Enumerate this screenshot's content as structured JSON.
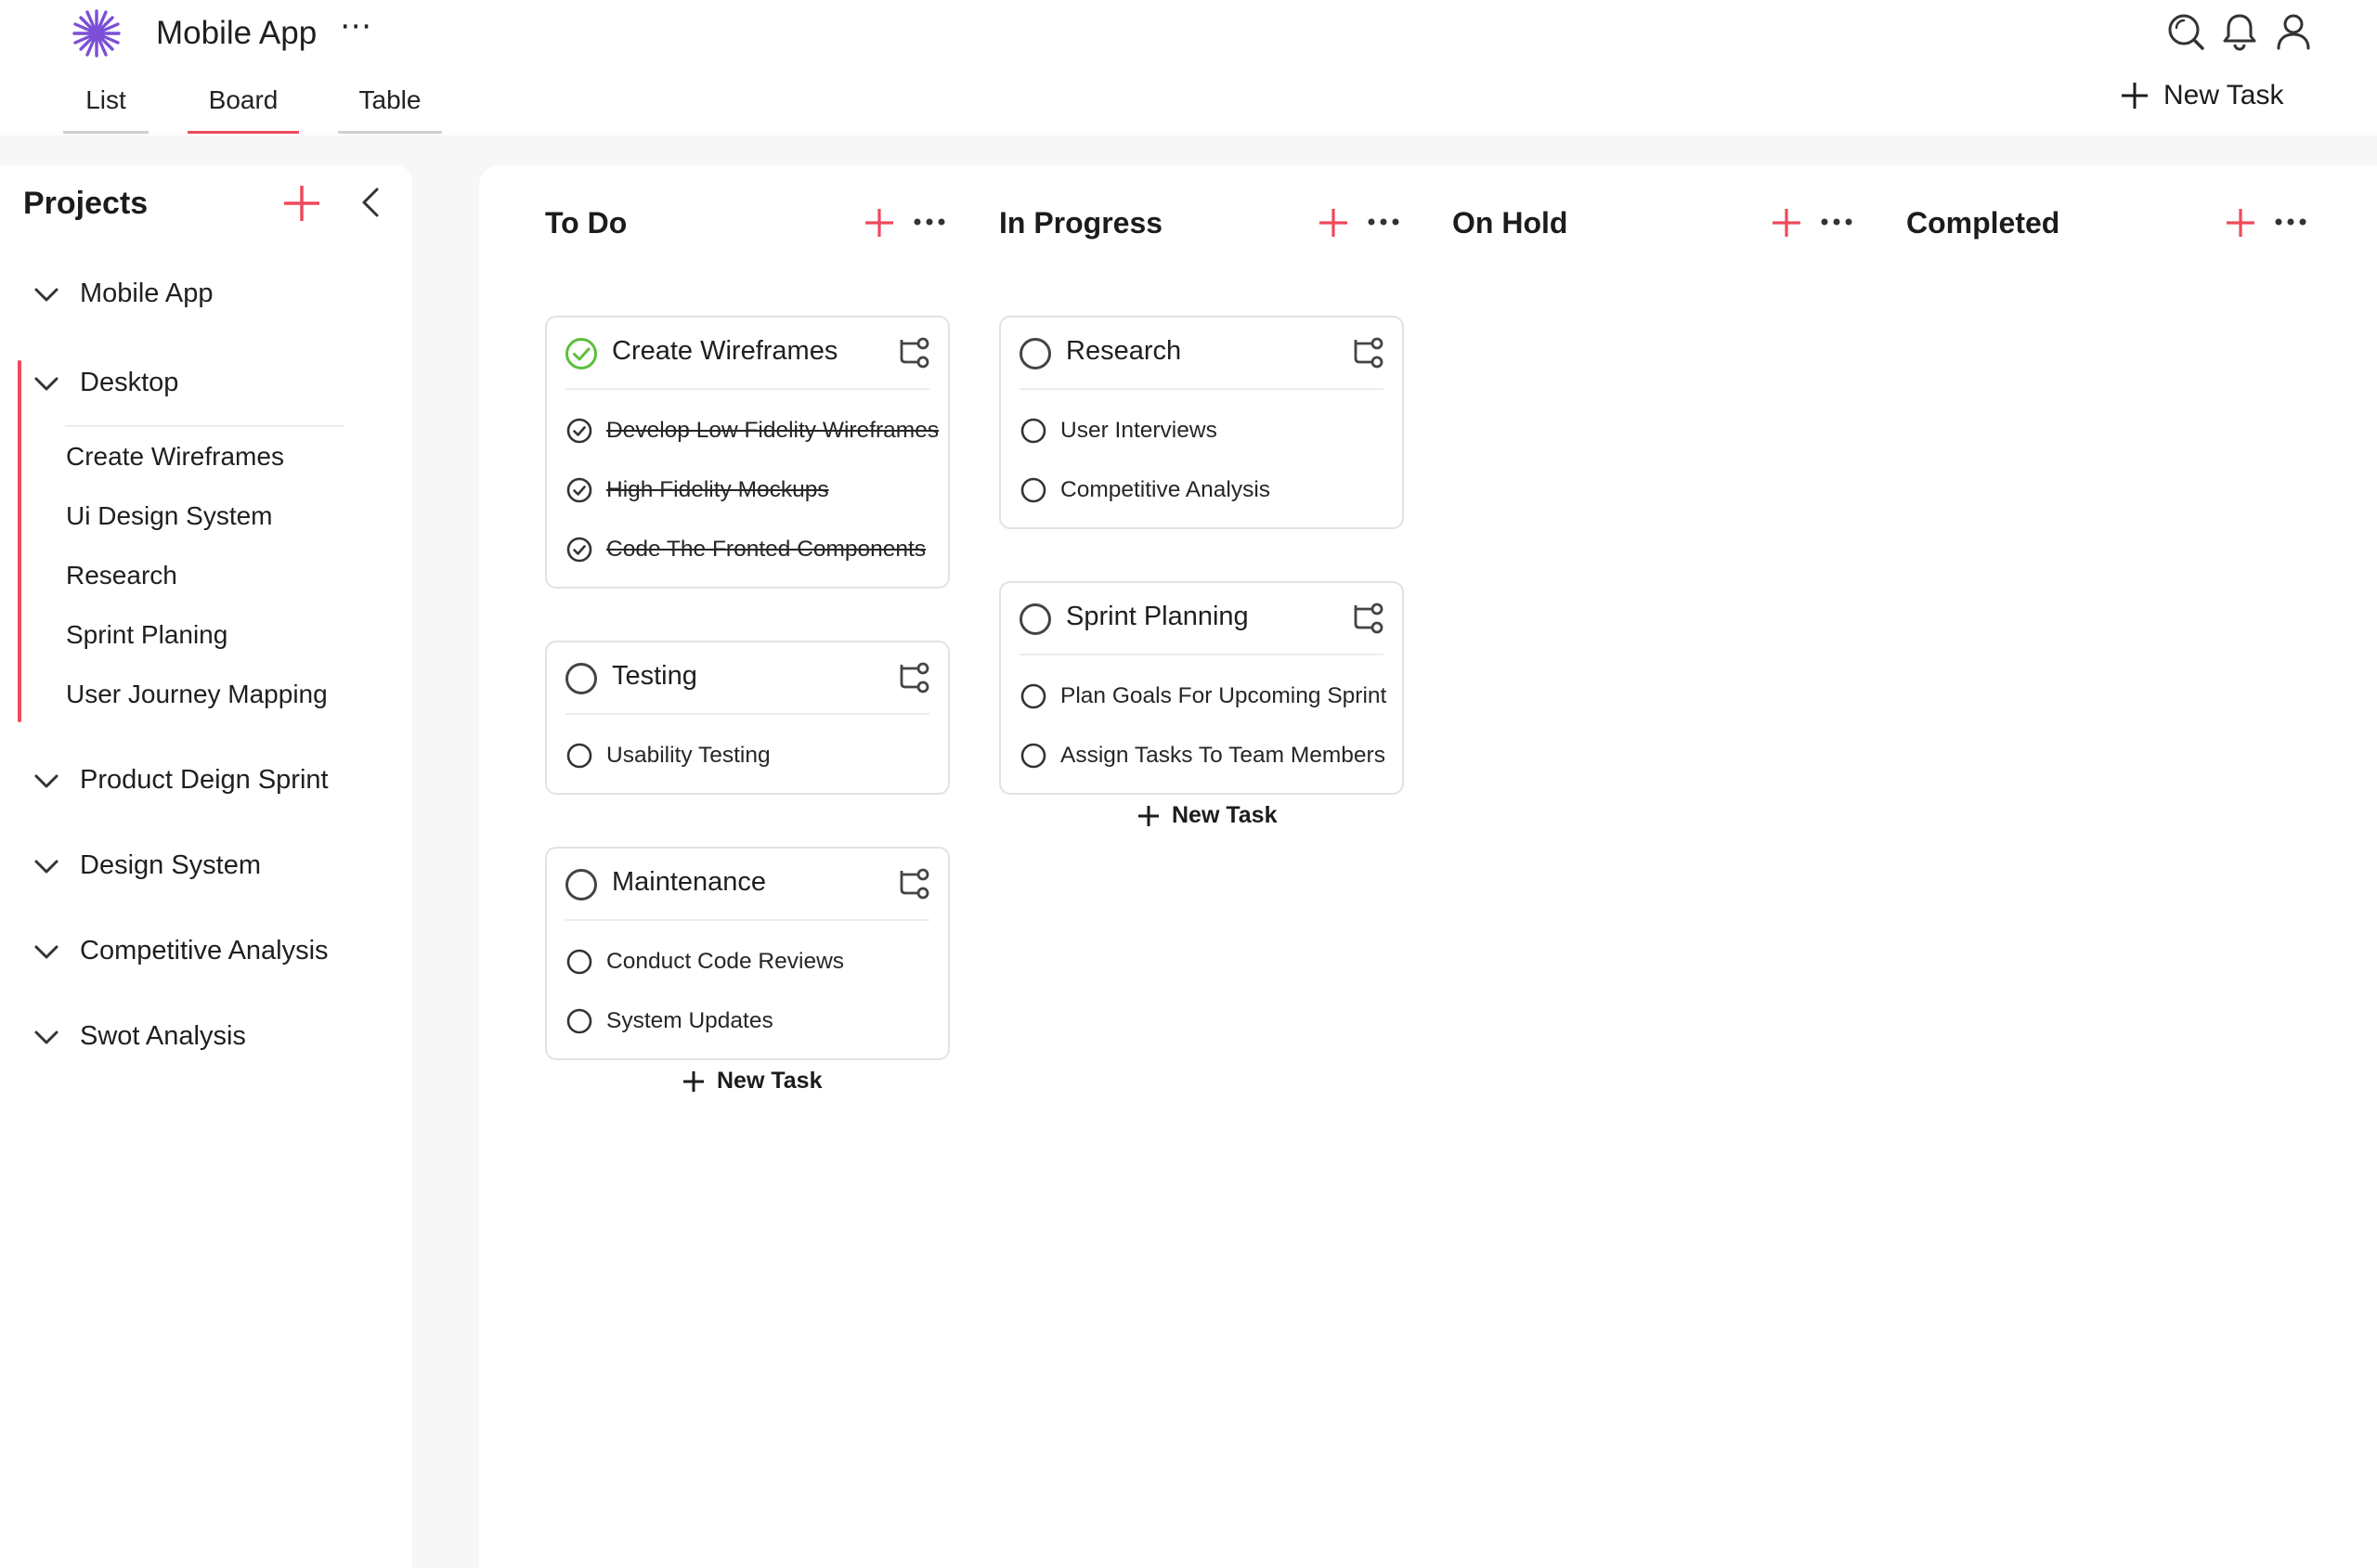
{
  "header": {
    "app_title": "Mobile App",
    "menu_glyph": "⋯",
    "tabs": [
      {
        "label": "List"
      },
      {
        "label": "Board"
      },
      {
        "label": "Table"
      }
    ],
    "new_task_label": "New Task",
    "icons": [
      "search-icon",
      "bell-icon",
      "user-icon"
    ],
    "accent_color": "#ee4a5c",
    "logo_color": "#7b4fd6"
  },
  "sidebar": {
    "title": "Projects",
    "projects": [
      {
        "label": "Mobile App"
      },
      {
        "label": "Desktop"
      },
      {
        "label": "Product Deign Sprint"
      },
      {
        "label": "Design System"
      },
      {
        "label": "Competitive Analysis"
      },
      {
        "label": "Swot Analysis"
      }
    ],
    "desktop_items": [
      {
        "label": "Create Wireframes"
      },
      {
        "label": "Ui Design System"
      },
      {
        "label": "Research"
      },
      {
        "label": "Sprint Planing"
      },
      {
        "label": "User Journey Mapping"
      }
    ]
  },
  "board": {
    "columns": [
      {
        "title": "To Do"
      },
      {
        "title": "In Progress"
      },
      {
        "title": "On Hold"
      },
      {
        "title": "Completed"
      }
    ],
    "new_task_label": "New Task",
    "cards": {
      "wireframes": {
        "title": "Create Wireframes",
        "status": "done",
        "subtasks": [
          {
            "label": "Develop Low Fidelity Wireframes",
            "done": true
          },
          {
            "label": "High Fidelity Mockups",
            "done": true
          },
          {
            "label": "Code The Fronted Components",
            "done": true
          }
        ]
      },
      "testing": {
        "title": "Testing",
        "status": "open",
        "subtasks": [
          {
            "label": "Usability Testing",
            "done": false
          }
        ]
      },
      "maintenance": {
        "title": "Maintenance",
        "status": "open",
        "subtasks": [
          {
            "label": "Conduct Code Reviews",
            "done": false
          },
          {
            "label": "System Updates",
            "done": false
          }
        ]
      },
      "research": {
        "title": "Research",
        "status": "open",
        "subtasks": [
          {
            "label": "User Interviews",
            "done": false
          },
          {
            "label": "Competitive Analysis",
            "done": false
          }
        ]
      },
      "sprint": {
        "title": "Sprint Planning",
        "status": "open",
        "subtasks": [
          {
            "label": "Plan Goals For Upcoming Sprint",
            "done": false
          },
          {
            "label": "Assign Tasks To Team Members",
            "done": false
          }
        ]
      }
    }
  }
}
